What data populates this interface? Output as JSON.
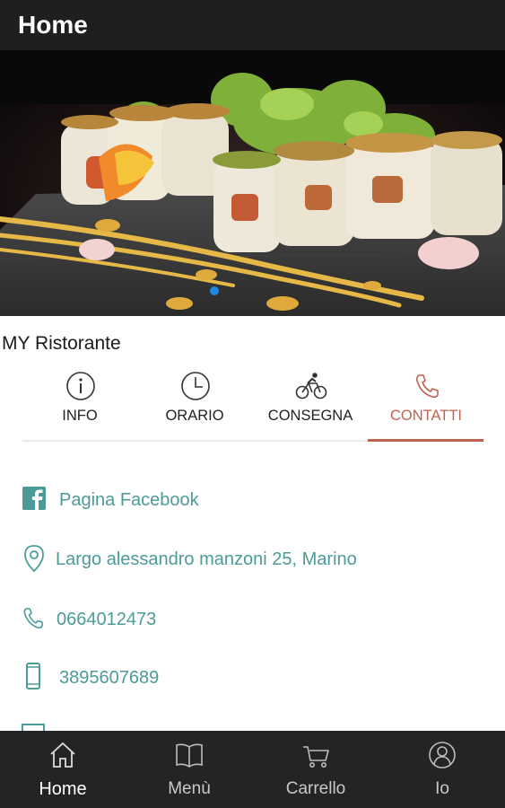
{
  "header": {
    "title": "Home"
  },
  "hero": {
    "alt_subject": "sushi"
  },
  "restaurant": {
    "name": "MY Ristorante"
  },
  "tabs": [
    {
      "label": "INFO",
      "icon": "info-icon",
      "active": false
    },
    {
      "label": "ORARIO",
      "icon": "clock-icon",
      "active": false
    },
    {
      "label": "CONSEGNA",
      "icon": "bicycle-icon",
      "active": false
    },
    {
      "label": "CONTATTI",
      "icon": "phone-icon",
      "active": true
    }
  ],
  "contacts": [
    {
      "icon": "facebook-icon",
      "text": "Pagina Facebook"
    },
    {
      "icon": "location-pin-icon",
      "text": "Largo alessandro manzoni 25, Marino"
    },
    {
      "icon": "phone-icon",
      "text": "0664012473"
    },
    {
      "icon": "mobile-phone-icon",
      "text": "3895607689"
    }
  ],
  "bottom_nav": [
    {
      "label": "Home",
      "icon": "home-icon",
      "active": true
    },
    {
      "label": "Menù",
      "icon": "book-icon",
      "active": false
    },
    {
      "label": "Carrello",
      "icon": "cart-icon",
      "active": false
    },
    {
      "label": "Io",
      "icon": "user-icon",
      "active": false
    }
  ],
  "colors": {
    "accent": "#c0614e",
    "link": "#4c9b98",
    "bar": "#1f1f1f",
    "nav_bg": "#242424"
  }
}
